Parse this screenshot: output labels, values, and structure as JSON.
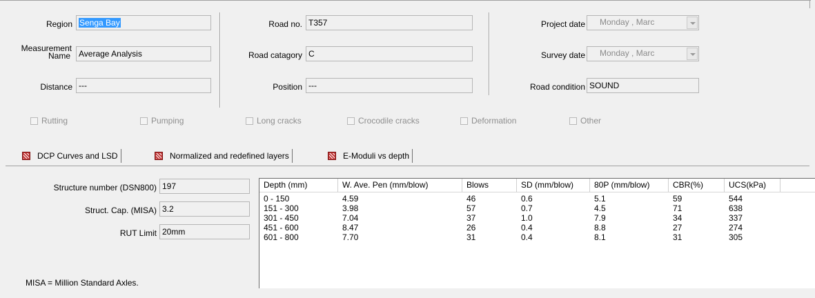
{
  "header": {
    "region_label": "Region",
    "region_value": "Senga Bay",
    "measurement_label_line1": "Measurement",
    "measurement_label_line2": "Name",
    "measurement_value": "Average Analysis",
    "distance_label": "Distance",
    "distance_value": "---",
    "road_no_label": "Road no.",
    "road_no_value": "T357",
    "road_category_label": "Road catagory",
    "road_category_value": "C",
    "position_label": "Position",
    "position_value": "---",
    "project_date_label": "Project date",
    "project_date_value": "Monday   ,   Marc",
    "survey_date_label": "Survey date",
    "survey_date_value": "Monday   ,   Marc",
    "road_condition_label": "Road condition",
    "road_condition_value": "SOUND"
  },
  "checkboxes": [
    {
      "label": "Rutting",
      "checked": false
    },
    {
      "label": "Pumping",
      "checked": false
    },
    {
      "label": "Long cracks",
      "checked": false
    },
    {
      "label": "Crocodile cracks",
      "checked": false
    },
    {
      "label": "Deformation",
      "checked": false
    },
    {
      "label": "Other",
      "checked": false
    }
  ],
  "tabs": [
    {
      "label": "DCP Curves and LSD",
      "icon": "chart-icon",
      "active": true
    },
    {
      "label": "Normalized and redefined layers",
      "icon": "chart-icon",
      "active": false
    },
    {
      "label": "E-Moduli vs depth",
      "icon": "chart-icon",
      "active": false
    }
  ],
  "summary": {
    "dsn_label": "Structure number (DSN800)",
    "dsn_value": "197",
    "misa_label": "Struct. Cap. (MISA)",
    "misa_value": "3.2",
    "rut_label": "RUT Limit",
    "rut_value": "20mm",
    "footnote": "MISA = Million Standard Axles."
  },
  "table": {
    "columns": [
      "Depth (mm)",
      "W. Ave. Pen (mm/blow)",
      "Blows",
      "SD (mm/blow)",
      "80P (mm/blow)",
      "CBR(%)",
      "UCS(kPa)"
    ],
    "rows": [
      [
        "0 - 150",
        "4.59",
        "46",
        "0.6",
        "5.1",
        "59",
        "544"
      ],
      [
        "151 - 300",
        "3.98",
        "57",
        "0.7",
        "4.5",
        "71",
        "638"
      ],
      [
        "301 - 450",
        "7.04",
        "37",
        "1.0",
        "7.9",
        "34",
        "337"
      ],
      [
        "451 - 600",
        "8.47",
        "26",
        "0.4",
        "8.8",
        "27",
        "274"
      ],
      [
        "601 - 800",
        "7.70",
        "31",
        "0.4",
        "8.1",
        "31",
        "305"
      ]
    ]
  }
}
